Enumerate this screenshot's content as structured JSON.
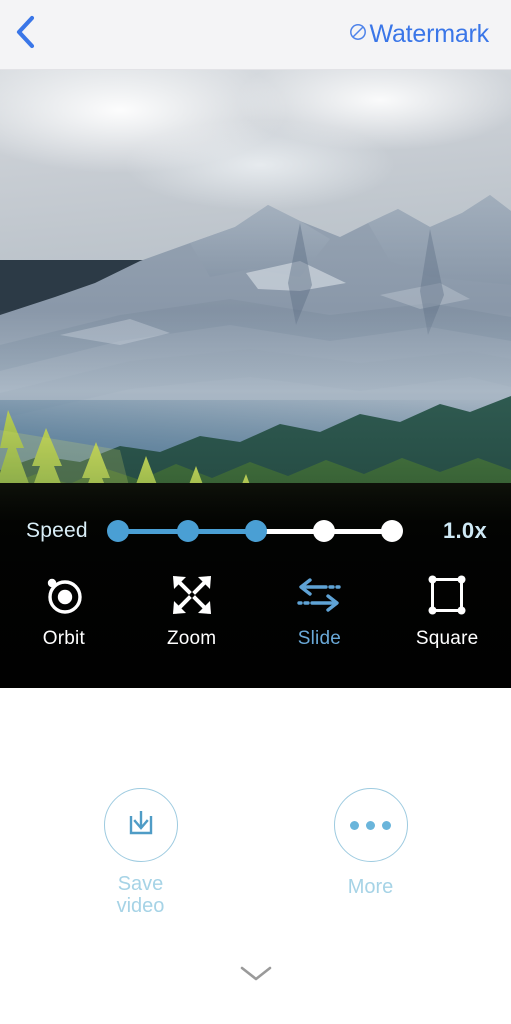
{
  "header": {
    "back_icon": "chevron-left-icon",
    "watermark_icon": "no-watermark-icon",
    "watermark_label": "Watermark",
    "accent_color": "#3a76e8",
    "background_color": "#f4f4f6"
  },
  "photo": {
    "description": "Alpine mountain range above a green pine forest and dark lake",
    "alt": "mountain-forest-lake-photo"
  },
  "controls": {
    "speed": {
      "label": "Speed",
      "value_label": "1.0x",
      "steps": 5,
      "selected_index": 3,
      "dots": [
        {
          "state": "on"
        },
        {
          "state": "on"
        },
        {
          "state": "on"
        },
        {
          "state": "off"
        },
        {
          "state": "off"
        }
      ],
      "fill_color": "#4a9fd4",
      "track_color": "#ffffff",
      "label_color": "#d9eef7"
    },
    "tools": [
      {
        "label": "Orbit",
        "icon": "orbit-icon",
        "selected": false
      },
      {
        "label": "Zoom",
        "icon": "expand-arrows-icon",
        "selected": false
      },
      {
        "label": "Slide",
        "icon": "slide-arrows-icon",
        "selected": true
      },
      {
        "label": "Square",
        "icon": "square-corners-icon",
        "selected": false
      }
    ],
    "selected_tool_color": "#6aa9d8",
    "tool_color": "#ffffff"
  },
  "bottom": {
    "actions": [
      {
        "label": "Save\nvideo",
        "label_line1": "Save",
        "label_line2": "video",
        "icon": "download-tray-icon"
      },
      {
        "label": "More",
        "icon": "ellipsis-icon"
      }
    ],
    "accent_color": "#a6d3e6",
    "collapse_icon": "chevron-down-icon"
  }
}
